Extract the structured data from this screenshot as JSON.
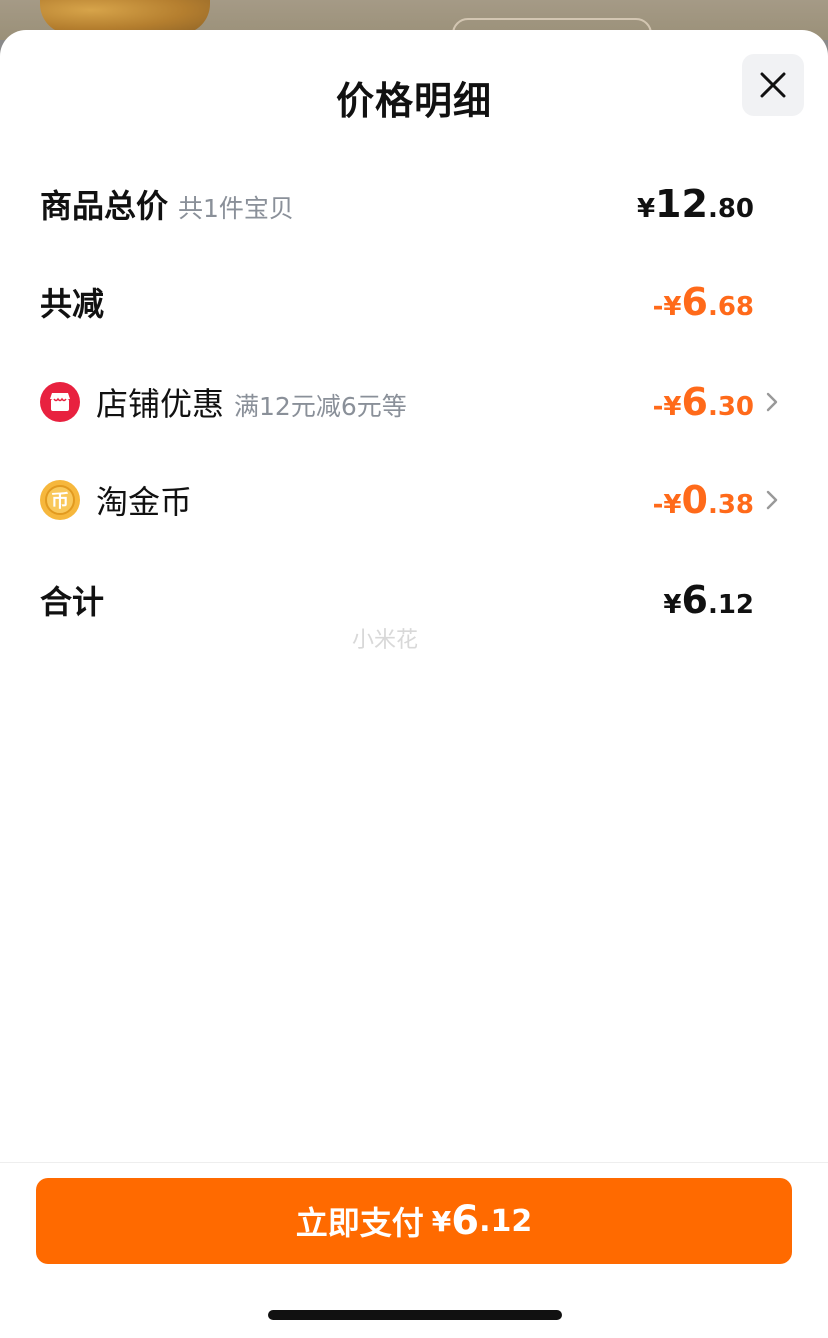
{
  "sheet": {
    "title": "价格明细"
  },
  "rows": {
    "subtotal": {
      "label": "商品总价",
      "sub": "共1件宝贝",
      "amount": {
        "currency": "¥",
        "int": "12",
        "dec": ".80"
      }
    },
    "total_discount": {
      "label": "共减",
      "amount": {
        "currency": "-¥",
        "int": "6",
        "dec": ".68"
      }
    },
    "store_discount": {
      "icon": "store-badge-icon",
      "label": "店铺优惠",
      "sub": "满12元减6元等",
      "amount": {
        "currency": "-¥",
        "int": "6",
        "dec": ".30"
      }
    },
    "coins": {
      "icon": "gold-coin-icon",
      "label": "淘金币",
      "amount": {
        "currency": "-¥",
        "int": "0",
        "dec": ".38"
      }
    },
    "total": {
      "label": "合计",
      "amount": {
        "currency": "¥",
        "int": "6",
        "dec": ".12"
      }
    }
  },
  "watermark": "小米花",
  "pay_button": {
    "label": "立即支付",
    "amount": {
      "currency": "¥",
      "int": "6",
      "dec": ".12"
    }
  },
  "colors": {
    "accent": "#ff6a00",
    "discount": "#ff6a1a",
    "store_badge": "#e8213f",
    "coin": "#f6b73c"
  }
}
